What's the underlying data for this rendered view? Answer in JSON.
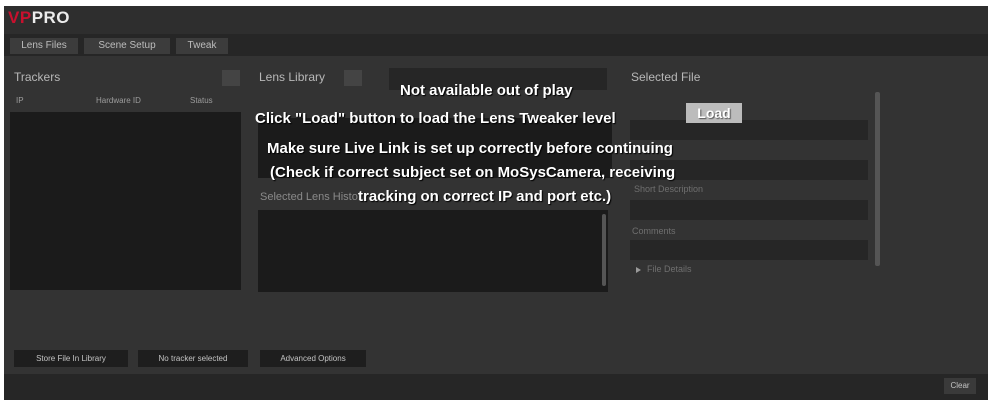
{
  "app": {
    "logo_vp": "VP",
    "logo_pro": "PRO"
  },
  "tabs": [
    "Lens Files",
    "Scene Setup",
    "Tweak"
  ],
  "trackers": {
    "title": "Trackers",
    "columns": [
      "IP",
      "Hardware ID",
      "Status"
    ]
  },
  "lens_library": {
    "title": "Lens Library",
    "selected_lens_title": "Selected Lens Histo..."
  },
  "selected_file": {
    "title": "Selected File",
    "field_labels": [
      "Short Description",
      "Comments"
    ],
    "file_details": "File Details"
  },
  "overlay": {
    "not_available": "Not available out of play",
    "click_load": "Click \"Load\" button to load the Lens Tweaker level",
    "load_button": "Load",
    "live_link_line1": "Make sure Live Link is set up correctly before continuing",
    "live_link_line2": "(Check if correct subject set on MoSysCamera, receiving",
    "live_link_line3": "tracking on correct IP and port etc.)"
  },
  "buttons": {
    "store_file": "Store File In Library",
    "no_tracker": "No tracker selected",
    "advanced_options": "Advanced Options",
    "clear": "Clear"
  }
}
